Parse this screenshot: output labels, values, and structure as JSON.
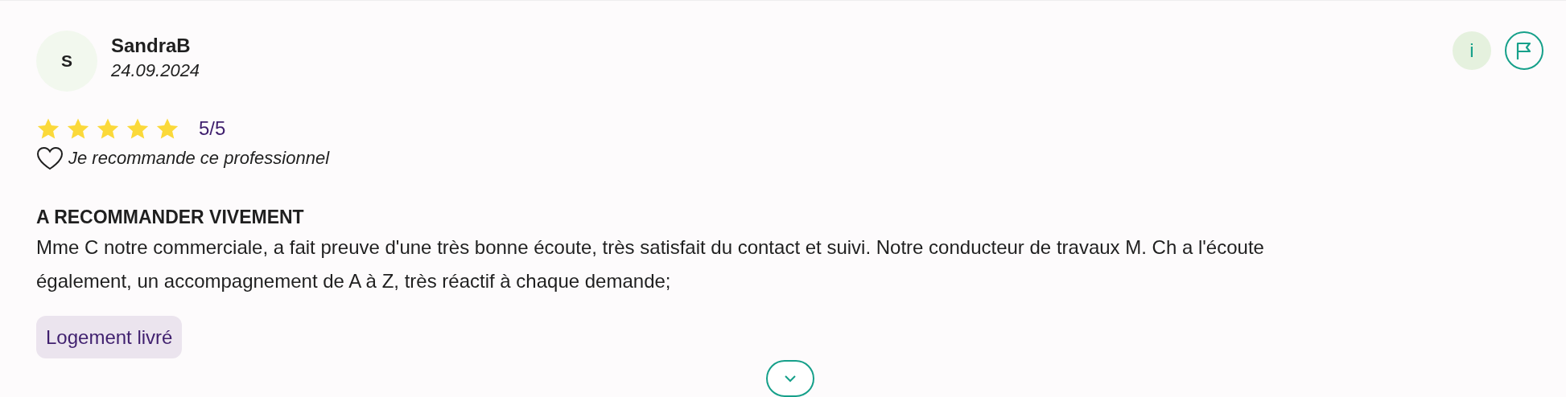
{
  "review": {
    "avatar_letter": "S",
    "author": "SandraB",
    "date": "24.09.2024",
    "stars": 5,
    "score": "5/5",
    "recommends": false,
    "recommend_text": "Je recommande ce professionnel",
    "title": "A RECOMMANDER VIVEMENT",
    "body": "Mme C notre commerciale, a fait preuve d'une très bonne écoute, très satisfait du contact et suivi. Notre conducteur de travaux M. Ch a l'écoute également, un accompagnement de A à Z, très réactif à chaque demande;",
    "tags": [
      "Logement livré"
    ],
    "info_label": "i",
    "expanded": false
  }
}
